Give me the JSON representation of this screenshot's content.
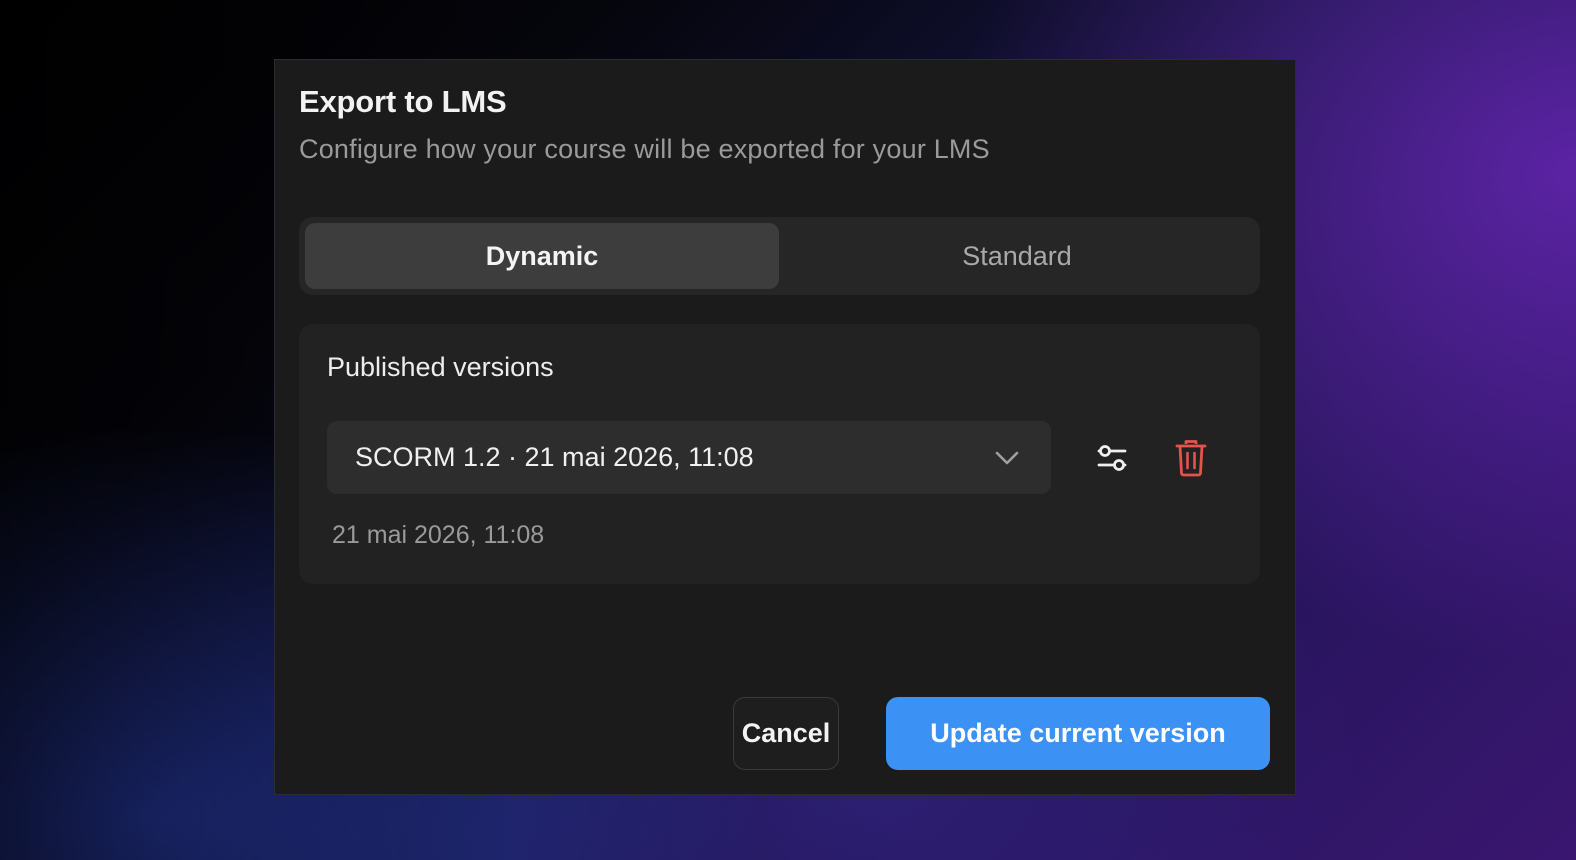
{
  "dialog": {
    "title": "Export to LMS",
    "subtitle": "Configure how your course will be exported for your LMS"
  },
  "tabs": [
    {
      "label": "Dynamic",
      "selected": true
    },
    {
      "label": "Standard",
      "selected": false
    }
  ],
  "published": {
    "heading": "Published versions",
    "selected_version": "SCORM 1.2 · 21 mai 2026, 11:08",
    "version_date": "21 mai 2026, 11:08",
    "icons": {
      "dropdown": "chevron-down-icon",
      "settings": "sliders-icon",
      "delete": "trash-icon"
    }
  },
  "footer": {
    "cancel_label": "Cancel",
    "primary_label": "Update current version"
  },
  "colors": {
    "primary": "#3c91f5",
    "danger": "#e5534b",
    "dialog_bg": "#1b1b1b"
  }
}
